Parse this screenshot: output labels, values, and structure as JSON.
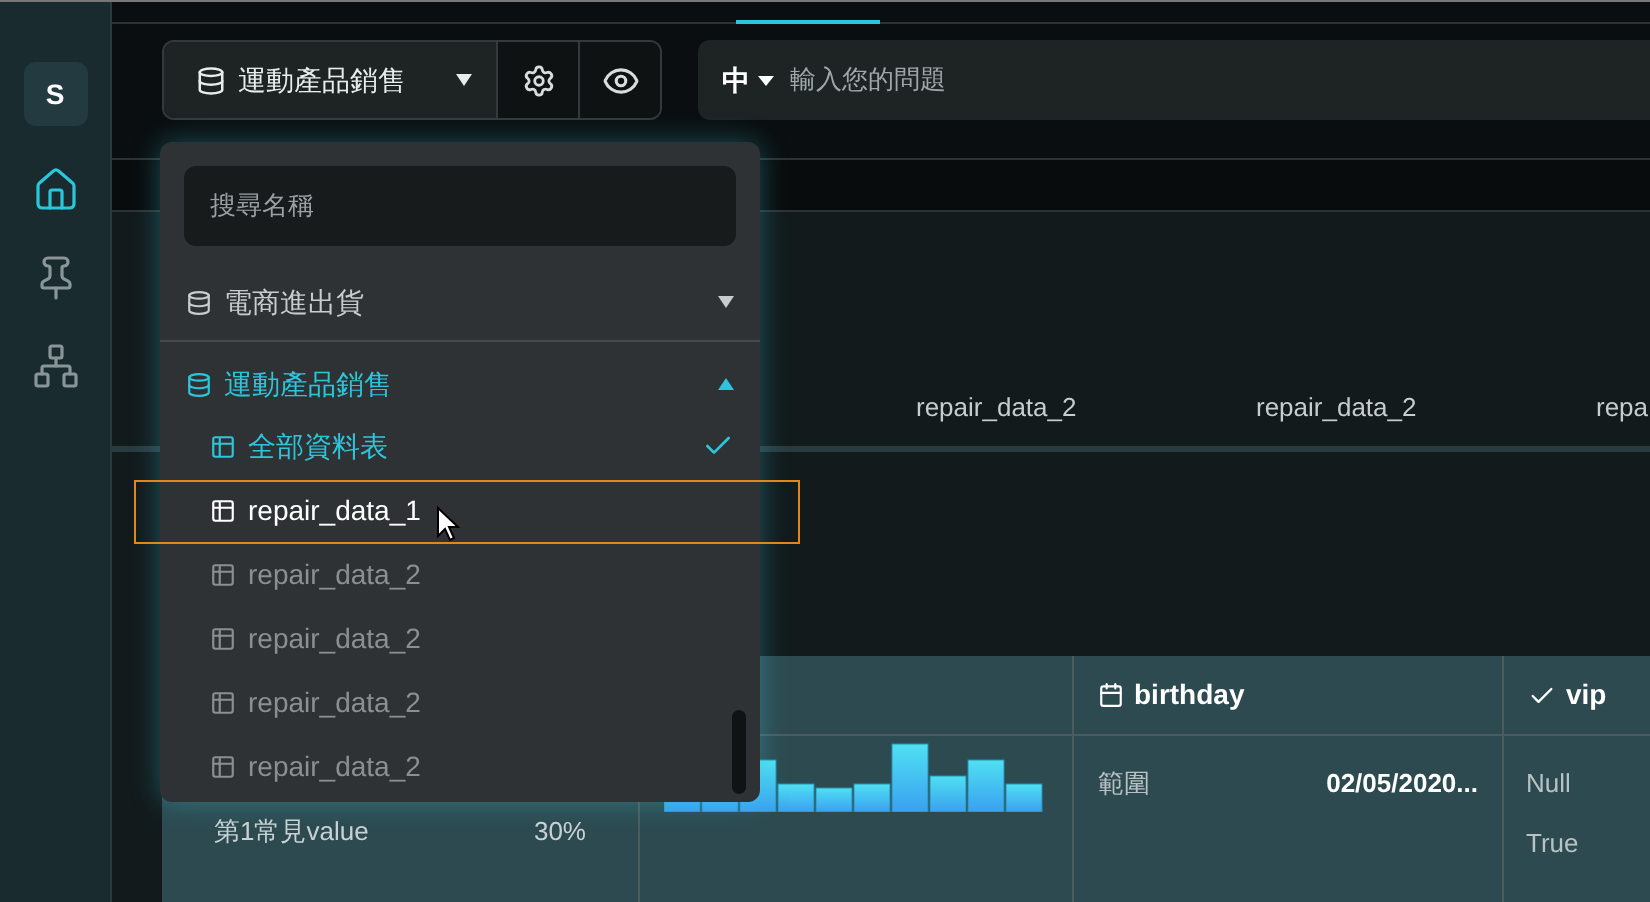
{
  "sidebar": {
    "avatar": "S",
    "items": [
      {
        "kind": "home",
        "selected": true
      },
      {
        "kind": "pin",
        "selected": false
      },
      {
        "kind": "sitemap",
        "selected": false
      }
    ]
  },
  "toolbar": {
    "dataset_button": "運動產品銷售",
    "language": "中",
    "question_placeholder": "輸入您的問題"
  },
  "column_headers": [
    "repair_data_2",
    "repair_data_2",
    "repa"
  ],
  "table": {
    "columns": [
      {
        "kind": "calendar",
        "label": "birthday"
      },
      {
        "kind": "check",
        "label": "vip"
      }
    ],
    "first_column_stats": [
      {
        "label": "第1常見value",
        "value": "30%"
      }
    ],
    "birthday_stats": [
      {
        "label": "範圍",
        "value": "02/05/2020..."
      }
    ],
    "vip_values": [
      "Null",
      "True"
    ]
  },
  "dropdown": {
    "search_placeholder": "搜尋名稱",
    "groups": [
      {
        "label": "電商進出貨",
        "expanded": false,
        "selected": false
      },
      {
        "label": "運動產品銷售",
        "expanded": true,
        "selected": true,
        "children": [
          {
            "label": "全部資料表",
            "selected": true,
            "hovered": false
          },
          {
            "label": "repair_data_1",
            "selected": false,
            "hovered": true
          },
          {
            "label": "repair_data_2",
            "selected": false,
            "hovered": false
          },
          {
            "label": "repair_data_2",
            "selected": false,
            "hovered": false
          },
          {
            "label": "repair_data_2",
            "selected": false,
            "hovered": false
          },
          {
            "label": "repair_data_2",
            "selected": false,
            "hovered": false
          }
        ]
      }
    ]
  }
}
